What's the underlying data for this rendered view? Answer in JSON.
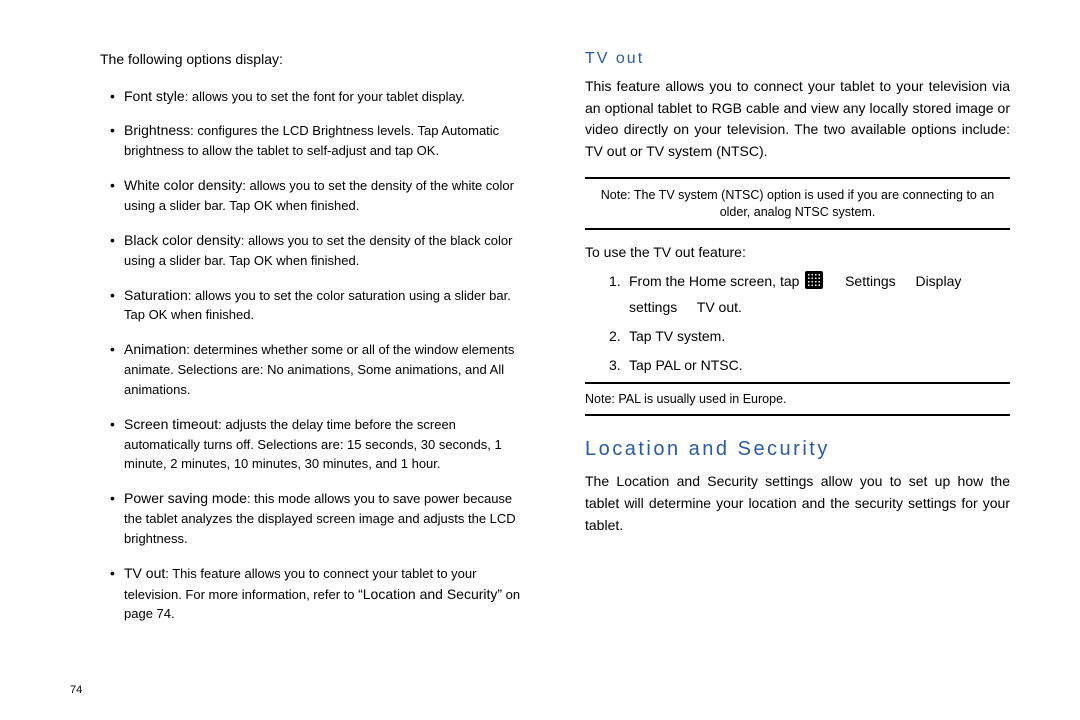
{
  "left": {
    "intro": "The following options display:",
    "bullets": [
      {
        "title": "Font style",
        "body": ": allows you to set the font for your tablet display."
      },
      {
        "title": "Brightness",
        "body": ": configures the LCD Brightness levels. Tap Automatic brightness to allow the tablet to self-adjust and tap OK."
      },
      {
        "title": "White color density",
        "body": ": allows you to set the density of the white color using a slider bar. Tap OK when finished."
      },
      {
        "title": "Black color density",
        "body": ": allows you to set the density of the black color using a slider bar. Tap OK when finished."
      },
      {
        "title": "Saturation",
        "body": ": allows you to set the color saturation using a slider bar. Tap OK when finished."
      },
      {
        "title": "Animation",
        "body": ": determines whether some or all of the window elements animate. Selections are: No animations, Some animations, and All animations."
      },
      {
        "title": "Screen timeout",
        "body": ": adjusts the delay time before the screen automatically turns off. Selections are: 15 seconds, 30 seconds, 1 minute, 2 minutes, 10 minutes, 30 minutes, and 1 hour."
      },
      {
        "title": "Power saving mode",
        "body": ": this mode allows you to save power because the tablet analyzes the displayed screen image and adjusts the LCD brightness."
      },
      {
        "title": "TV out",
        "body": ": This feature allows you to connect your tablet to your television. For more information, refer to ",
        "ref": "“Location and Security”",
        "ref_tail": " on page 74."
      }
    ]
  },
  "right": {
    "tvout_heading": "TV out",
    "tvout_para": "This feature allows you to connect your tablet to your television via an optional tablet to RGB cable and view any locally stored image or video directly on your television. The two available options include: TV out or TV system (NTSC).",
    "note1_label": "Note:",
    "note1_body": "The TV system (NTSC) option is used if you are connecting to an older, analog NTSC system.",
    "lead": "To use the TV out feature:",
    "step1_pre": "From the Home screen, tap ",
    "step1_settings": "Settings",
    "step1_display": "Display settings",
    "step1_tvout": "TV out",
    "step2_pre": "Tap ",
    "step2_b": "TV system",
    "step3_pre": "Tap ",
    "step3_b1": "PAL",
    "step3_mid": " or ",
    "step3_b2": "NTSC",
    "note2": "Note: PAL is usually used in Europe.",
    "loc_heading": "Location and Security",
    "loc_para": "The Location and Security settings allow you to set up how the tablet will determine your location and the security settings for your tablet."
  },
  "pagenum": "74"
}
